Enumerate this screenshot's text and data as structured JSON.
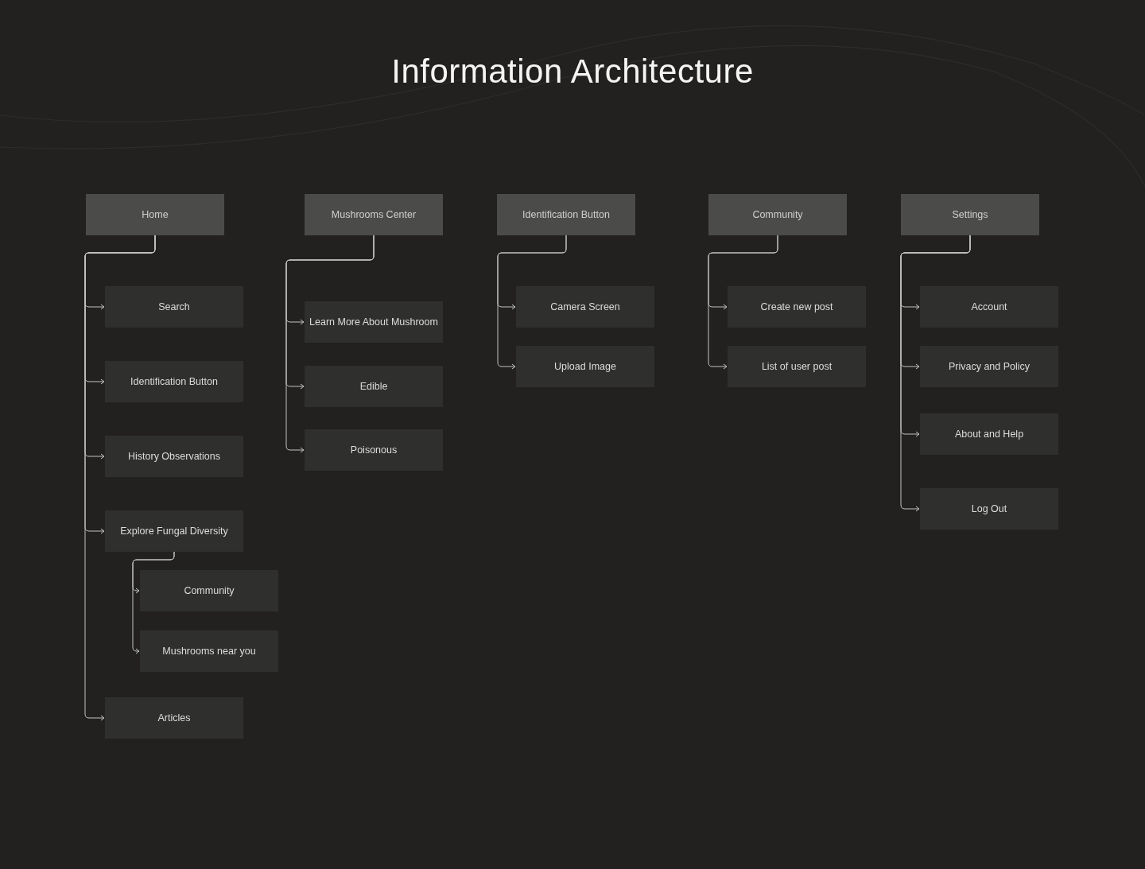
{
  "title": "Information Architecture",
  "columns": [
    {
      "label": "Home",
      "children": [
        {
          "label": "Search"
        },
        {
          "label": "Identification Button"
        },
        {
          "label": "History Observations"
        },
        {
          "label": "Explore Fungal Diversity",
          "children": [
            {
              "label": "Community"
            },
            {
              "label": "Mushrooms near you"
            }
          ]
        },
        {
          "label": "Articles"
        }
      ]
    },
    {
      "label": "Mushrooms Center",
      "children": [
        {
          "label": "Learn More About Mushroom"
        },
        {
          "label": "Edible"
        },
        {
          "label": "Poisonous"
        }
      ]
    },
    {
      "label": "Identification Button",
      "children": [
        {
          "label": "Camera Screen"
        },
        {
          "label": "Upload Image"
        }
      ]
    },
    {
      "label": "Community",
      "children": [
        {
          "label": "Create new post"
        },
        {
          "label": "List of user post"
        }
      ]
    },
    {
      "label": "Settings",
      "children": [
        {
          "label": "Account"
        },
        {
          "label": "Privacy and Policy"
        },
        {
          "label": "About and Help"
        },
        {
          "label": "Log Out"
        }
      ]
    }
  ]
}
